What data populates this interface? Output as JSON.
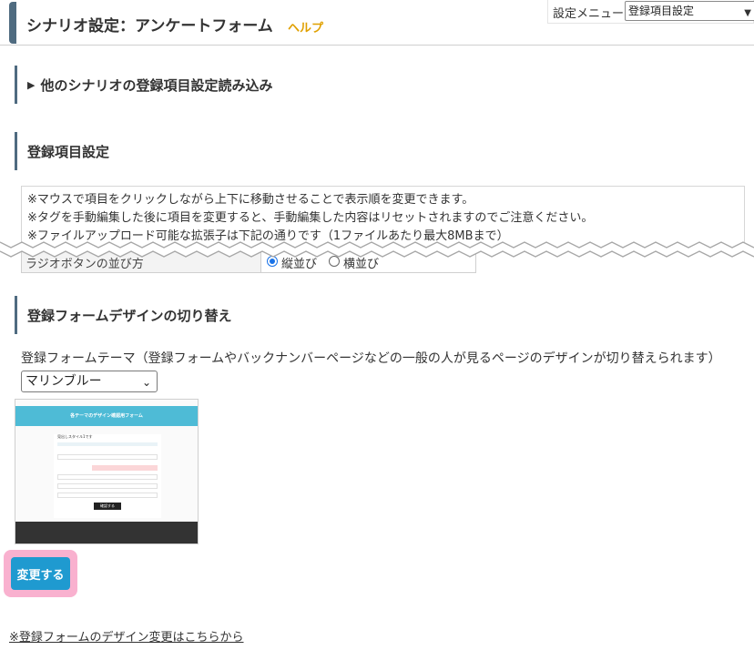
{
  "header": {
    "title": "シナリオ設定：アンケートフォーム",
    "help_label": "ヘルプ"
  },
  "settings_menu": {
    "label": "設定メニュー",
    "selected": "登録項目設定"
  },
  "sections": {
    "import": "他のシナリオの登録項目設定読み込み",
    "fields": "登録項目設定",
    "design": "登録フォームデザインの切り替え"
  },
  "notices": [
    "※マウスで項目をクリックしながら上下に移動させることで表示順を変更できます。",
    "※タグを手動編集した後に項目を変更すると、手動編集した内容はリセットされますのでご注意ください。",
    "※ファイルアップロード可能な拡張子は下記の通りです（1ファイルあたり最大8MBまで）"
  ],
  "radio_setting": {
    "label": "ラジオボタンの並び方",
    "options": [
      "縦並び",
      "横並び"
    ],
    "selected": "縦並び"
  },
  "theme": {
    "label": "登録フォームテーマ（登録フォームやバックナンバーページなどの一般の人が見るページのデザインが切り替えられます）",
    "selected": "マリンブルー",
    "preview_header": "各テーマのデザイン確認用フォーム",
    "preview_title": "見出しスタイル1です",
    "preview_button": "確認する"
  },
  "change_button": "変更する",
  "design_link": "※登録フォームのデザイン変更はこちらから",
  "colors": {
    "accent": "#4f6b80",
    "help": "#e0a000",
    "button": "#1f9ad0",
    "highlight": "#f9b1cf",
    "preview_header": "#4ebbd6"
  }
}
